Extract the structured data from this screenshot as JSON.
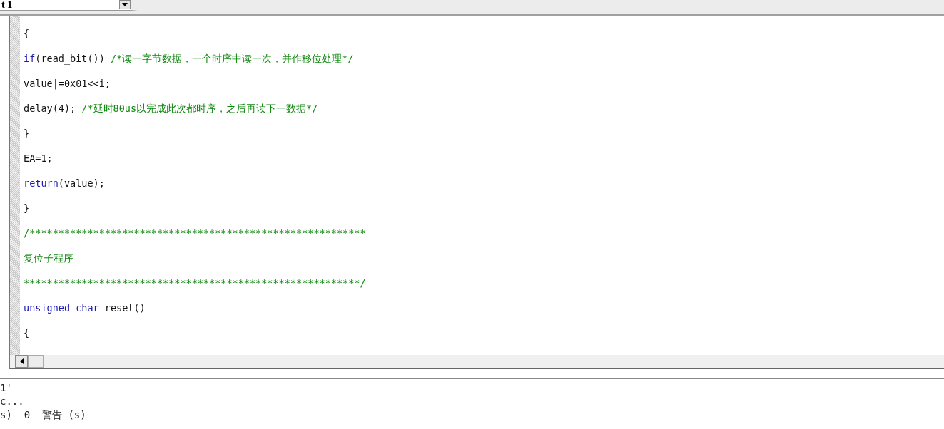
{
  "toolbar": {
    "target_dropdown": {
      "value": "t 1"
    }
  },
  "editor": {
    "lines": [
      [
        {
          "kind": "plain",
          "text": "{"
        }
      ],
      [
        {
          "kind": "keyword",
          "text": "if"
        },
        {
          "kind": "plain",
          "text": "(read_bit()) "
        },
        {
          "kind": "comment",
          "text": "/*读一字节数据，一个时序中读一次，并作移位处理*/"
        }
      ],
      [
        {
          "kind": "plain",
          "text": "value|=0x01<<i;"
        }
      ],
      [
        {
          "kind": "plain",
          "text": "delay(4); "
        },
        {
          "kind": "comment",
          "text": "/*延时80us以完成此次都时序，之后再读下一数据*/"
        }
      ],
      [
        {
          "kind": "plain",
          "text": "}"
        }
      ],
      [
        {
          "kind": "plain",
          "text": "EA=1;"
        }
      ],
      [
        {
          "kind": "keyword",
          "text": "return"
        },
        {
          "kind": "plain",
          "text": "(value);"
        }
      ],
      [
        {
          "kind": "plain",
          "text": "}"
        }
      ],
      [
        {
          "kind": "comment",
          "text": "/**********************************************************"
        }
      ],
      [
        {
          "kind": "comment",
          "text": "复位子程序"
        }
      ],
      [
        {
          "kind": "comment",
          "text": "**********************************************************/"
        }
      ],
      [
        {
          "kind": "keyword",
          "text": "unsigned char"
        },
        {
          "kind": "plain",
          "text": " reset()"
        }
      ],
      [
        {
          "kind": "plain",
          "text": "{"
        }
      ]
    ]
  },
  "output": {
    "lines": [
      "1'",
      "c...",
      "s)  0  警告 (s)"
    ]
  }
}
